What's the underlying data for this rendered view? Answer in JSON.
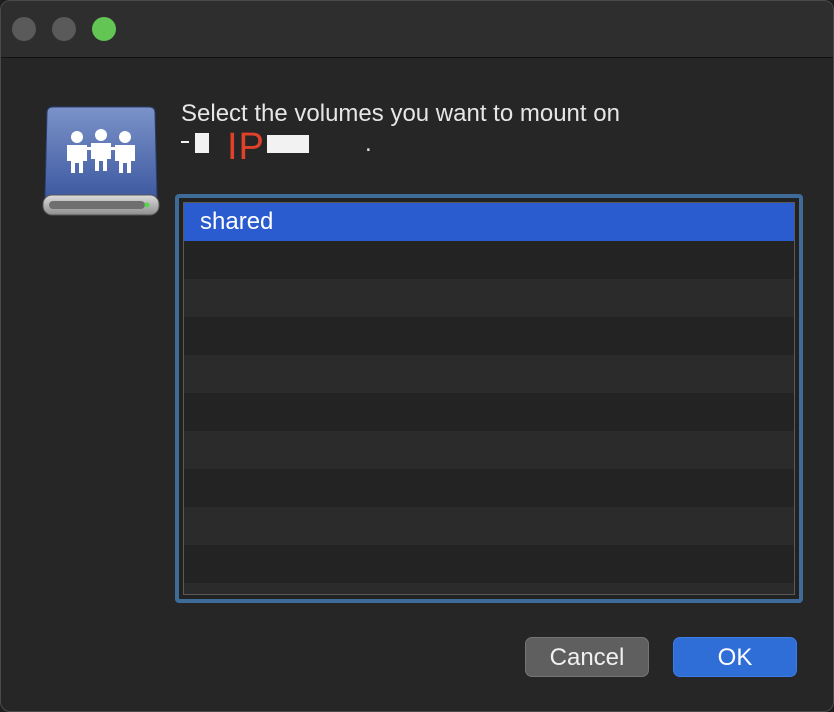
{
  "window": {
    "traffic_lights": [
      "close",
      "minimize",
      "zoom"
    ]
  },
  "dialog": {
    "icon": "shared-server-drive-icon",
    "prompt": "Select the volumes you want to mount on",
    "host_overlay_text": "IP",
    "host_suffix": ".",
    "volumes": [
      {
        "name": "shared",
        "selected": true
      },
      {
        "name": "",
        "selected": false
      },
      {
        "name": "",
        "selected": false
      },
      {
        "name": "",
        "selected": false
      },
      {
        "name": "",
        "selected": false
      },
      {
        "name": "",
        "selected": false
      },
      {
        "name": "",
        "selected": false
      },
      {
        "name": "",
        "selected": false
      },
      {
        "name": "",
        "selected": false
      },
      {
        "name": "",
        "selected": false
      },
      {
        "name": "",
        "selected": false
      }
    ],
    "cancel_label": "Cancel",
    "ok_label": "OK"
  },
  "colors": {
    "accent": "#2a5ccf",
    "zoom_button": "#62c554",
    "annotation_red": "#e0412a"
  }
}
